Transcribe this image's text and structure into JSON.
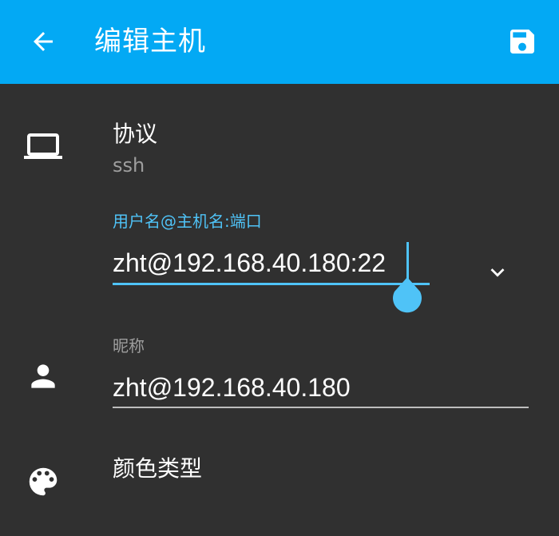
{
  "appbar": {
    "title": "编辑主机",
    "back_icon": "arrow-back-icon",
    "save_icon": "save-icon",
    "color": "#03A9F4"
  },
  "protocol": {
    "title": "协议",
    "value": "ssh",
    "icon": "laptop-icon"
  },
  "host_field": {
    "label": "用户名@主机名:端口",
    "value": "zht@192.168.40.180:22",
    "accent": "#4FC3F7"
  },
  "nickname_field": {
    "label": "昵称",
    "value": "zht@192.168.40.180",
    "icon": "person-icon"
  },
  "color_type": {
    "title": "颜色类型",
    "icon": "palette-icon"
  }
}
